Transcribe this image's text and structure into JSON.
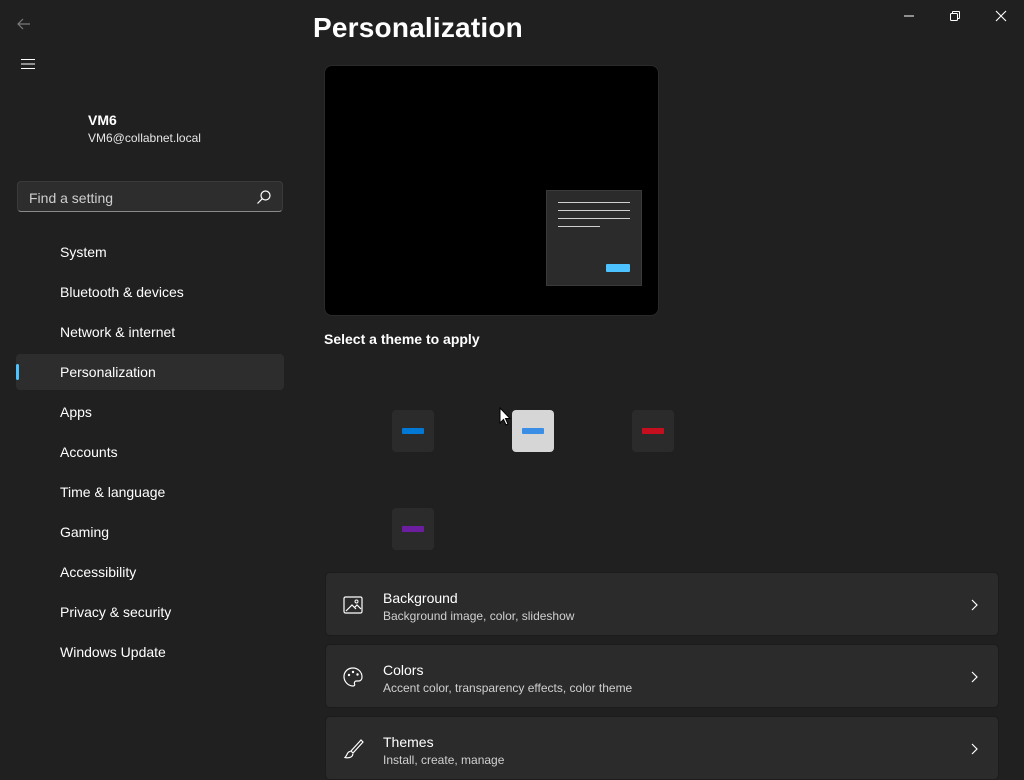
{
  "window": {
    "title": "Personalization",
    "controls": [
      "minimize",
      "maximize",
      "close"
    ]
  },
  "account": {
    "name": "VM6",
    "email": "VM6@collabnet.local"
  },
  "search": {
    "placeholder": "Find a setting",
    "value": ""
  },
  "sidebar": {
    "items": [
      {
        "label": "System",
        "active": false
      },
      {
        "label": "Bluetooth & devices",
        "active": false
      },
      {
        "label": "Network & internet",
        "active": false
      },
      {
        "label": "Personalization",
        "active": true
      },
      {
        "label": "Apps",
        "active": false
      },
      {
        "label": "Accounts",
        "active": false
      },
      {
        "label": "Time & language",
        "active": false
      },
      {
        "label": "Gaming",
        "active": false
      },
      {
        "label": "Accessibility",
        "active": false
      },
      {
        "label": "Privacy & security",
        "active": false
      },
      {
        "label": "Windows Update",
        "active": false
      }
    ]
  },
  "themes": {
    "heading": "Select a theme to apply",
    "items": [
      {
        "name": "theme-dark-blue",
        "tile_color": "#2b2b2b",
        "accent": "#0078d4"
      },
      {
        "name": "theme-light",
        "tile_color": "#d6d6d6",
        "accent": "#3a8ee6"
      },
      {
        "name": "theme-dark-red",
        "tile_color": "#2b2b2b",
        "accent": "#c50f1f"
      },
      {
        "name": "theme-dark-purple",
        "tile_color": "#2b2b2b",
        "accent": "#6b1fa0"
      }
    ]
  },
  "cards": [
    {
      "title": "Background",
      "subtitle": "Background image, color, slideshow",
      "icon": "image-icon"
    },
    {
      "title": "Colors",
      "subtitle": "Accent color, transparency effects, color theme",
      "icon": "palette-icon"
    },
    {
      "title": "Themes",
      "subtitle": "Install, create, manage",
      "icon": "brush-icon"
    }
  ],
  "colors": {
    "background": "#202020",
    "card": "#2b2b2b",
    "accent": "#4cc2ff"
  }
}
